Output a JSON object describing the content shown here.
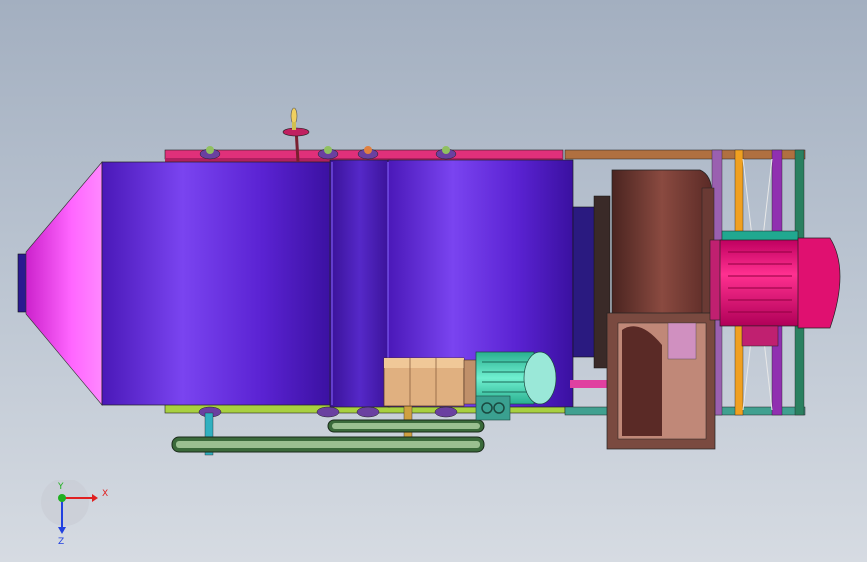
{
  "viewport": {
    "background_top": "#a3afc0",
    "background_bottom": "#d6dbe2"
  },
  "model": {
    "components": [
      "inlet-hood",
      "chamber-body",
      "top-frame-rail",
      "lifting-eye",
      "bottom-frame-rail",
      "drive-chain",
      "gear-reducer",
      "drive-motor",
      "fan-impeller-housing",
      "fan-outlet",
      "main-motor",
      "fan-base-frame"
    ],
    "colors": {
      "chamber": "#5b22d6",
      "hood": "#ee44ee",
      "rail_top": "#e0307a",
      "rail_bottom": "#a8d040",
      "fan_housing": "#6a3a34",
      "main_motor": "#e0107a",
      "drive_motor": "#40d0b0",
      "gearbox": "#e0b080",
      "frame_orange": "#f0a020",
      "frame_purple": "#9030b0",
      "frame_green": "#2a8060"
    }
  },
  "triad": {
    "x_label": "X",
    "y_label": "Y",
    "z_label": "Z",
    "x_color": "#e02020",
    "y_color": "#20b020",
    "z_color": "#2040e0"
  }
}
